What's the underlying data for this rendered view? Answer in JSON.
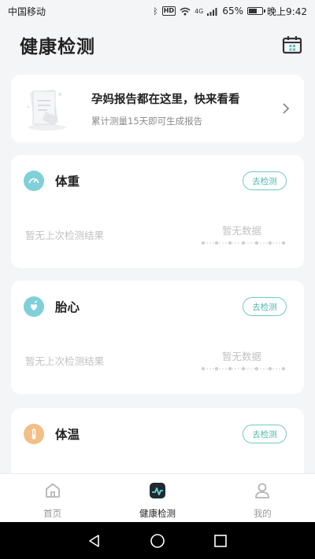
{
  "status_bar": {
    "carrier": "中国移动",
    "battery": "65%",
    "battery_level": 0.65,
    "time": "晚上9:42",
    "hd": "HD",
    "signal_label": "4G"
  },
  "header": {
    "title": "健康检测"
  },
  "report_card": {
    "title": "孕妈报告都在这里，快来看看",
    "subtitle": "累计测量15天即可生成报告"
  },
  "measures": [
    {
      "title": "体重",
      "button": "去检测",
      "last": "暂无上次检测结果",
      "empty": "暂无数据",
      "icon_color": "#7fd0d8"
    },
    {
      "title": "胎心",
      "button": "去检测",
      "last": "暂无上次检测结果",
      "empty": "暂无数据",
      "icon_color": "#7fd0d8"
    },
    {
      "title": "体温",
      "button": "去检测",
      "last": "",
      "empty": "",
      "icon_color": "#f2bf86"
    }
  ],
  "bottom_nav": {
    "items": [
      {
        "label": "首页",
        "icon": "home-icon"
      },
      {
        "label": "健康检测",
        "icon": "health-monitor-icon"
      },
      {
        "label": "我的",
        "icon": "user-icon"
      }
    ],
    "active_index": 1
  },
  "colors": {
    "accent": "#4fb8ae",
    "background": "#f4f5f7"
  }
}
